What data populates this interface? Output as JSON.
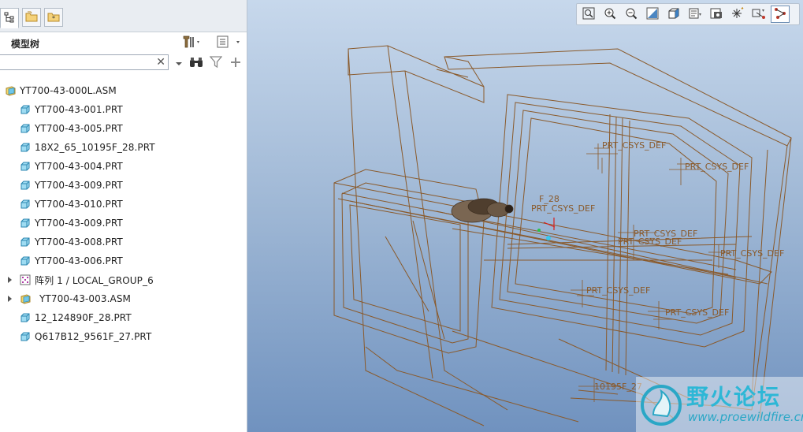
{
  "left_panel": {
    "tabs": [
      {
        "name": "model-tree-tab",
        "icon": "tree-structure-icon"
      },
      {
        "name": "folder-browser-tab",
        "icon": "folder-icon"
      },
      {
        "name": "favorites-tab",
        "icon": "star-folder-icon"
      }
    ],
    "tree_title": "模型树",
    "header_buttons": [
      "settings-tools-icon",
      "tree-filters-icon"
    ],
    "search": {
      "value": "",
      "placeholder": "",
      "clear_glyph": "✕"
    },
    "search_buttons": [
      "binoculars-icon",
      "filter-icon",
      "add-icon"
    ],
    "tree_items": [
      {
        "label": "YT700-43-000L.ASM",
        "type": "assembly",
        "level": 0,
        "expandable": false
      },
      {
        "label": "YT700-43-001.PRT",
        "type": "part",
        "level": 1,
        "expandable": false
      },
      {
        "label": "YT700-43-005.PRT",
        "type": "part",
        "level": 1,
        "expandable": false
      },
      {
        "label": "18X2_65_10195F_28.PRT",
        "type": "part",
        "level": 1,
        "expandable": false
      },
      {
        "label": "YT700-43-004.PRT",
        "type": "part",
        "level": 1,
        "expandable": false
      },
      {
        "label": "YT700-43-009.PRT",
        "type": "part",
        "level": 1,
        "expandable": false
      },
      {
        "label": "YT700-43-010.PRT",
        "type": "part",
        "level": 1,
        "expandable": false
      },
      {
        "label": "YT700-43-009.PRT",
        "type": "part",
        "level": 1,
        "expandable": false
      },
      {
        "label": "YT700-43-008.PRT",
        "type": "part",
        "level": 1,
        "expandable": false
      },
      {
        "label": "YT700-43-006.PRT",
        "type": "part",
        "level": 1,
        "expandable": false
      },
      {
        "label": "阵列 1 / LOCAL_GROUP_6",
        "type": "pattern",
        "level": 1,
        "expandable": true
      },
      {
        "label": "YT700-43-003.ASM",
        "type": "subassembly",
        "level": 1,
        "expandable": true
      },
      {
        "label": "12_124890F_28.PRT",
        "type": "part",
        "level": 1,
        "expandable": false
      },
      {
        "label": "Q617B12_9561F_27.PRT",
        "type": "part",
        "level": 1,
        "expandable": false
      }
    ]
  },
  "viewport": {
    "toolbar": [
      "refit-icon",
      "zoom-in-icon",
      "zoom-out-icon",
      "repaint-icon",
      "display-style-icon",
      "saved-views-icon",
      "view-manager-icon",
      "datum-display-icon",
      "spin-center-icon",
      "annotation-display-icon"
    ],
    "csys_labels": [
      "PRT_CSYS_DEF",
      "PRT_CSYS_DEF",
      "PRT_CSYS_DEF",
      "PRT_CSYS_DEF",
      "PRT_CSYS_DEF",
      "PRT_CSYS_DEF",
      "PRT_CSYS_DEF",
      "PRT_CSYS_DEF"
    ],
    "other_labels": [
      "F_28",
      "10195F_27"
    ],
    "watermark": {
      "title": "野火论坛",
      "url": "www.proewildfire.cn"
    },
    "wire_color": "#8a5a2b"
  }
}
